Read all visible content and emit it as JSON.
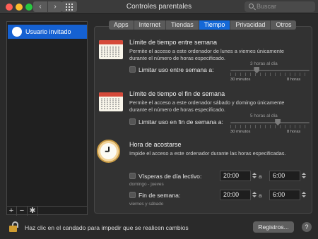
{
  "window": {
    "title": "Controles parentales",
    "search_placeholder": "Buscar",
    "nav_back_glyph": "‹",
    "nav_forward_glyph": "›"
  },
  "sidebar": {
    "users": [
      {
        "name": "Usuario invitado",
        "selected": true
      }
    ],
    "toolbar": {
      "add": "+",
      "remove": "−",
      "gear": "✱"
    }
  },
  "tabs": [
    {
      "label": "Apps",
      "active": false
    },
    {
      "label": "Internet",
      "active": false
    },
    {
      "label": "Tiendas",
      "active": false
    },
    {
      "label": "Tiempo",
      "active": true
    },
    {
      "label": "Privacidad",
      "active": false
    },
    {
      "label": "Otros",
      "active": false
    }
  ],
  "weekday": {
    "title": "Límite de tiempo entre semana",
    "desc_line1": "Permite el acceso a este ordenador de lunes a viernes únicamente",
    "desc_line2": "durante el número de horas especificado.",
    "checkbox_label": "Limitar uso entre semana a:",
    "checked": false,
    "slider_value_label": "3 horas al día",
    "slider_min": "30 minutos",
    "slider_max": "8 horas",
    "slider_hours": 3
  },
  "weekend": {
    "title": "Límite de tiempo el fin de semana",
    "desc_line1": "Permite el acceso a este ordenador sábado y domingo únicamente",
    "desc_line2": "durante el número de horas especificado.",
    "checkbox_label": "Limitar uso en fin de semana a:",
    "checked": false,
    "slider_value_label": "5 horas al día",
    "slider_min": "30 minutos",
    "slider_max": "8 horas",
    "slider_hours": 5
  },
  "bedtime": {
    "title": "Hora de acostarse",
    "desc": "Impide el acceso a este ordenador durante las horas especificadas.",
    "school_nights": {
      "label": "Vísperas de día lectivo:",
      "sub": "domingo - jueves",
      "from": "20:00",
      "to": "6:00",
      "separator": "a",
      "checked": false
    },
    "weekend": {
      "label": "Fin de semana:",
      "sub": "viernes y sábado",
      "from": "20:00",
      "to": "6:00",
      "separator": "a",
      "checked": false
    }
  },
  "footer": {
    "lock_text": "Haz clic en el candado para impedir que se realicen cambios",
    "logs_button": "Registros...",
    "help_glyph": "?"
  },
  "colors": {
    "accent": "#1468d7",
    "selection": "#1561d2",
    "panel": "#323232",
    "background": "#2a2a2a"
  }
}
